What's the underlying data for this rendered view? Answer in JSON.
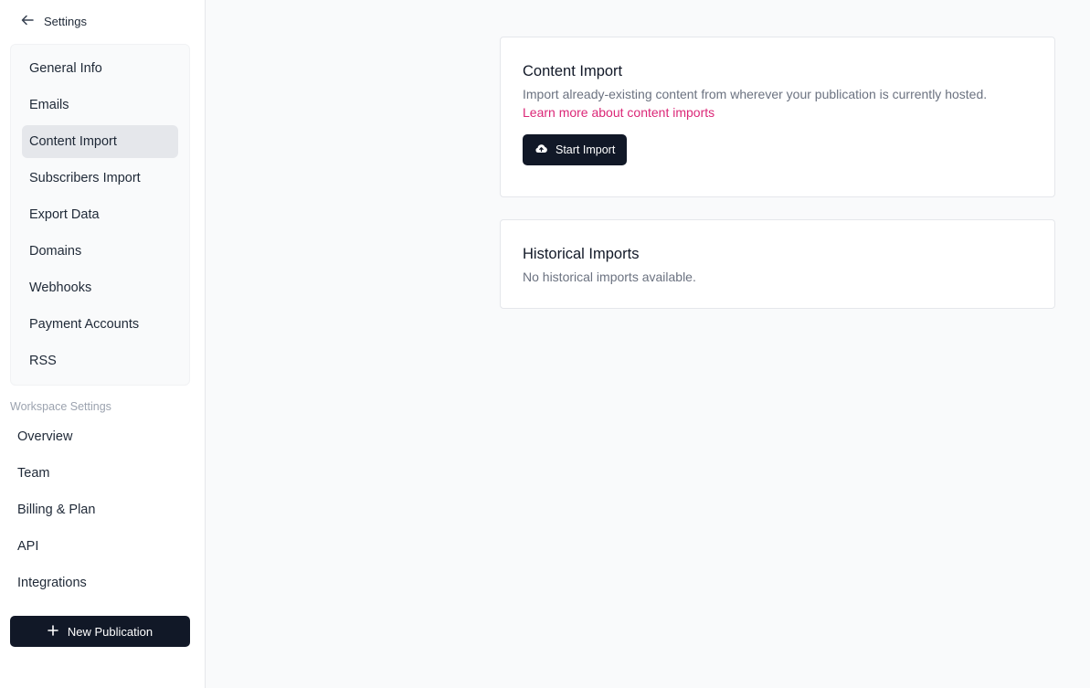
{
  "sidebar": {
    "back_label": "Settings",
    "publication_items": [
      {
        "label": "General Info"
      },
      {
        "label": "Emails"
      },
      {
        "label": "Content Import",
        "active": true
      },
      {
        "label": "Subscribers Import"
      },
      {
        "label": "Export Data"
      },
      {
        "label": "Domains"
      },
      {
        "label": "Webhooks"
      },
      {
        "label": "Payment Accounts"
      },
      {
        "label": "RSS"
      }
    ],
    "workspace_label": "Workspace Settings",
    "workspace_items": [
      {
        "label": "Overview"
      },
      {
        "label": "Team"
      },
      {
        "label": "Billing & Plan"
      },
      {
        "label": "API"
      },
      {
        "label": "Integrations"
      }
    ],
    "new_publication_label": "New Publication"
  },
  "content_import": {
    "title": "Content Import",
    "description": "Import already-existing content from wherever your publication is currently hosted.",
    "link_label": "Learn more about content imports",
    "start_button_label": "Start Import"
  },
  "historical_imports": {
    "title": "Historical Imports",
    "empty_text": "No historical imports available."
  },
  "icons": {
    "back": "arrow-left-icon",
    "new_publication": "plus-icon",
    "start_import": "cloud-upload-icon"
  },
  "colors": {
    "primary_dark": "#111827",
    "link_accent": "#db2777",
    "active_nav": "#e5e7eb"
  }
}
